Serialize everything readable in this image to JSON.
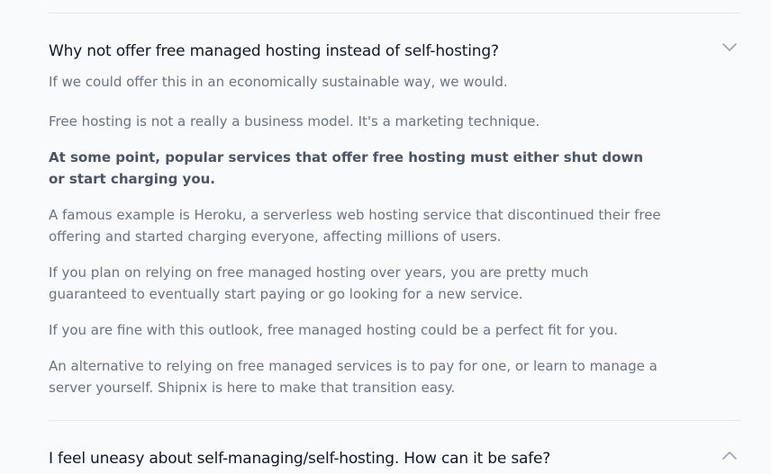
{
  "faq": [
    {
      "question": "Why not offer free managed hosting instead of self-hosting?",
      "expanded": true,
      "answer": [
        "If we could offer this in an economically sustainable way, we would.",
        "Free hosting is not a really a business model. It's a marketing technique.",
        "At some point, popular services that offer free hosting must either shut down or start charging you.",
        "A famous example is Heroku, a serverless web hosting service that discontinued their free offering and started charging everyone, affecting millions of users.",
        "If you plan on relying on free managed hosting over years, you are pretty much guaranteed to eventually start paying or go looking for a new service.",
        "If you are fine with this outlook, free managed hosting could be a perfect fit for you.",
        "An alternative to relying on free managed services is to pay for one, or learn to manage a server yourself. Shipnix is here to make that transition easy."
      ]
    },
    {
      "question": "I feel uneasy about self-managing/self-hosting. How can it be safe?",
      "expanded": false
    }
  ],
  "icons": {
    "toggle_open": "chevron-down-icon",
    "toggle_closed": "chevron-up-icon"
  },
  "colors": {
    "background": "#f9fafb",
    "question_text": "#111827",
    "answer_text": "#6b7280",
    "divider": "#e5e7eb",
    "chevron": "#9ca3af"
  }
}
